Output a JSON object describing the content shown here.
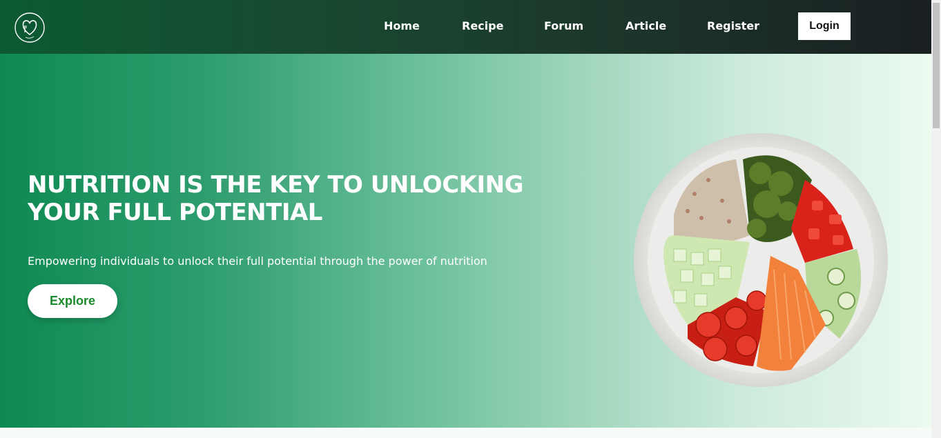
{
  "nav": {
    "logo_icon": "heart-fork-logo-icon",
    "links": [
      "Home",
      "Recipe",
      "Forum",
      "Article",
      "Register"
    ],
    "login_label": "Login"
  },
  "hero": {
    "title": "NUTRITION IS THE KEY TO UNLOCKING YOUR FULL POTENTIAL",
    "subtitle": "Empowering individuals to unlock their full potential through the power of nutrition",
    "explore_label": "Explore",
    "image_icon": "salad-bowl-image"
  },
  "colors": {
    "nav_dark": "#1a1f22",
    "nav_green": "#0c5a32",
    "hero_green": "#0e8a52",
    "hero_light": "#ecfaf0",
    "explore_text": "#1a8a2a"
  }
}
